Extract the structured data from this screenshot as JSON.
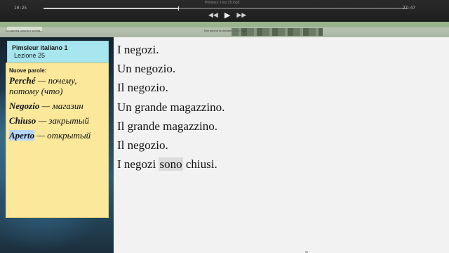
{
  "player": {
    "elapsed": "10:25",
    "remaining": "27:47",
    "progress": 0.37,
    "file_title": "Pimsleur 1 lez 25.mp3",
    "rewind_icon": "rewind-icon",
    "play_icon": "play-icon",
    "forward_icon": "fast-forward-icon"
  },
  "browser": {
    "tab_left": "La pizzeria propria è servita...",
    "tab_right": "Tutti perchè fa decidere / fatal qual..."
  },
  "note": {
    "title": "Pimsleur italiano 1",
    "lesson": "Lezione 25",
    "heading": "Nuove parole:",
    "entries": [
      {
        "word": "Perché",
        "translation": " — почему, потому (что)"
      },
      {
        "word": "Negozio",
        "translation": " — магазин"
      },
      {
        "word": "Chiuso",
        "translation": " — закрытый"
      },
      {
        "word": "Aperto",
        "translation": " — открытый"
      }
    ]
  },
  "doc": {
    "lines": [
      "I negozi.",
      "Un negozio.",
      "Il negozio.",
      "Un grande magazzino.",
      "Il grande magazzino.",
      "Il negozio."
    ],
    "last_line": {
      "before": "I negozi ",
      "highlight": "sono",
      "after": " chiusi."
    }
  }
}
